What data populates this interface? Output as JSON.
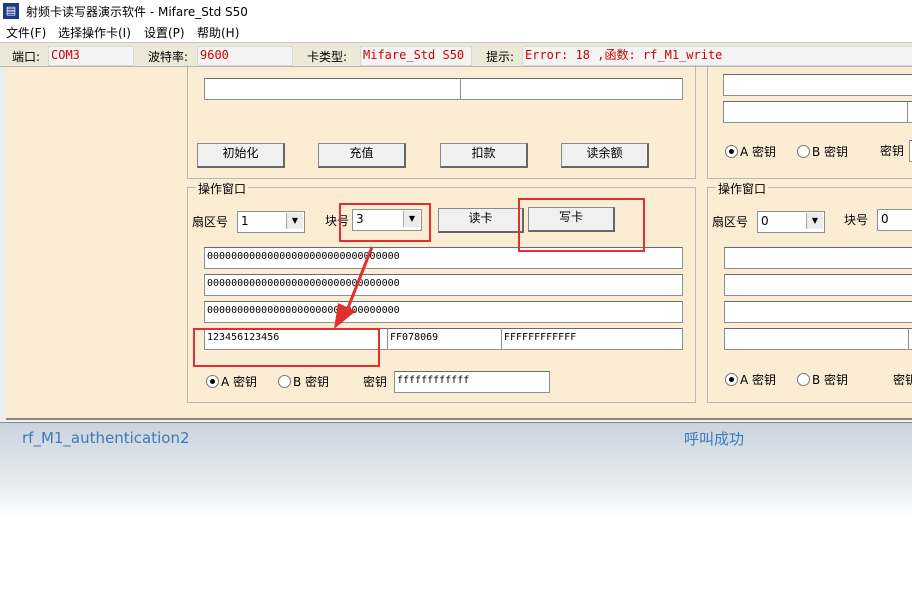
{
  "window": {
    "title": "射频卡读写器演示软件  -  Mifare_Std S50"
  },
  "menu": [
    "文件(F)",
    "选择操作卡(I)",
    "设置(P)",
    "帮助(H)"
  ],
  "status": {
    "port_label": "端口:",
    "port_value": "COM3",
    "baud_label": "波特率:",
    "baud_value": "9600",
    "card_type_label": "卡类型:",
    "card_type_value": "Mifare_Std S50",
    "hint_label": "提示:",
    "hint_value": "Error: 18 ,函数: rf_M1_write"
  },
  "top_buttons": [
    "初始化",
    "充值",
    "扣款",
    "读余额"
  ],
  "op_window": {
    "title": "操作窗口",
    "sector_label": "扇区号",
    "sector_value": "1",
    "block_label": "块号",
    "block_value": "3",
    "read_button": "读卡",
    "write_button": "写卡",
    "rows": [
      "00000000000000000000000000000000",
      "00000000000000000000000000000000",
      "00000000000000000000000000000000"
    ],
    "key_a_field": "123456123456",
    "access_bits_field": "FF078069",
    "key_b_field": "FFFFFFFFFFFF",
    "radio_a_label": "A 密钥",
    "radio_b_label": "B 密钥",
    "key_label": "密钥",
    "key_value": "ffffffffffff"
  },
  "right_panel": {
    "op_title": "操作窗口",
    "sector_label": "扇区号",
    "sector_value": "0",
    "block_label": "块号",
    "block_value": "0",
    "radio_a_label": "A 密钥",
    "radio_b_label": "B 密钥",
    "key_label": "密钥",
    "key_label_2": "密钥"
  },
  "log": {
    "func": "rf_M1_authentication2",
    "result": "呼叫成功"
  },
  "colors": {
    "panel_bg": "#fbecd4",
    "error_text": "#d00000",
    "highlight": "#e03030",
    "log_text": "#3c7ab8"
  }
}
